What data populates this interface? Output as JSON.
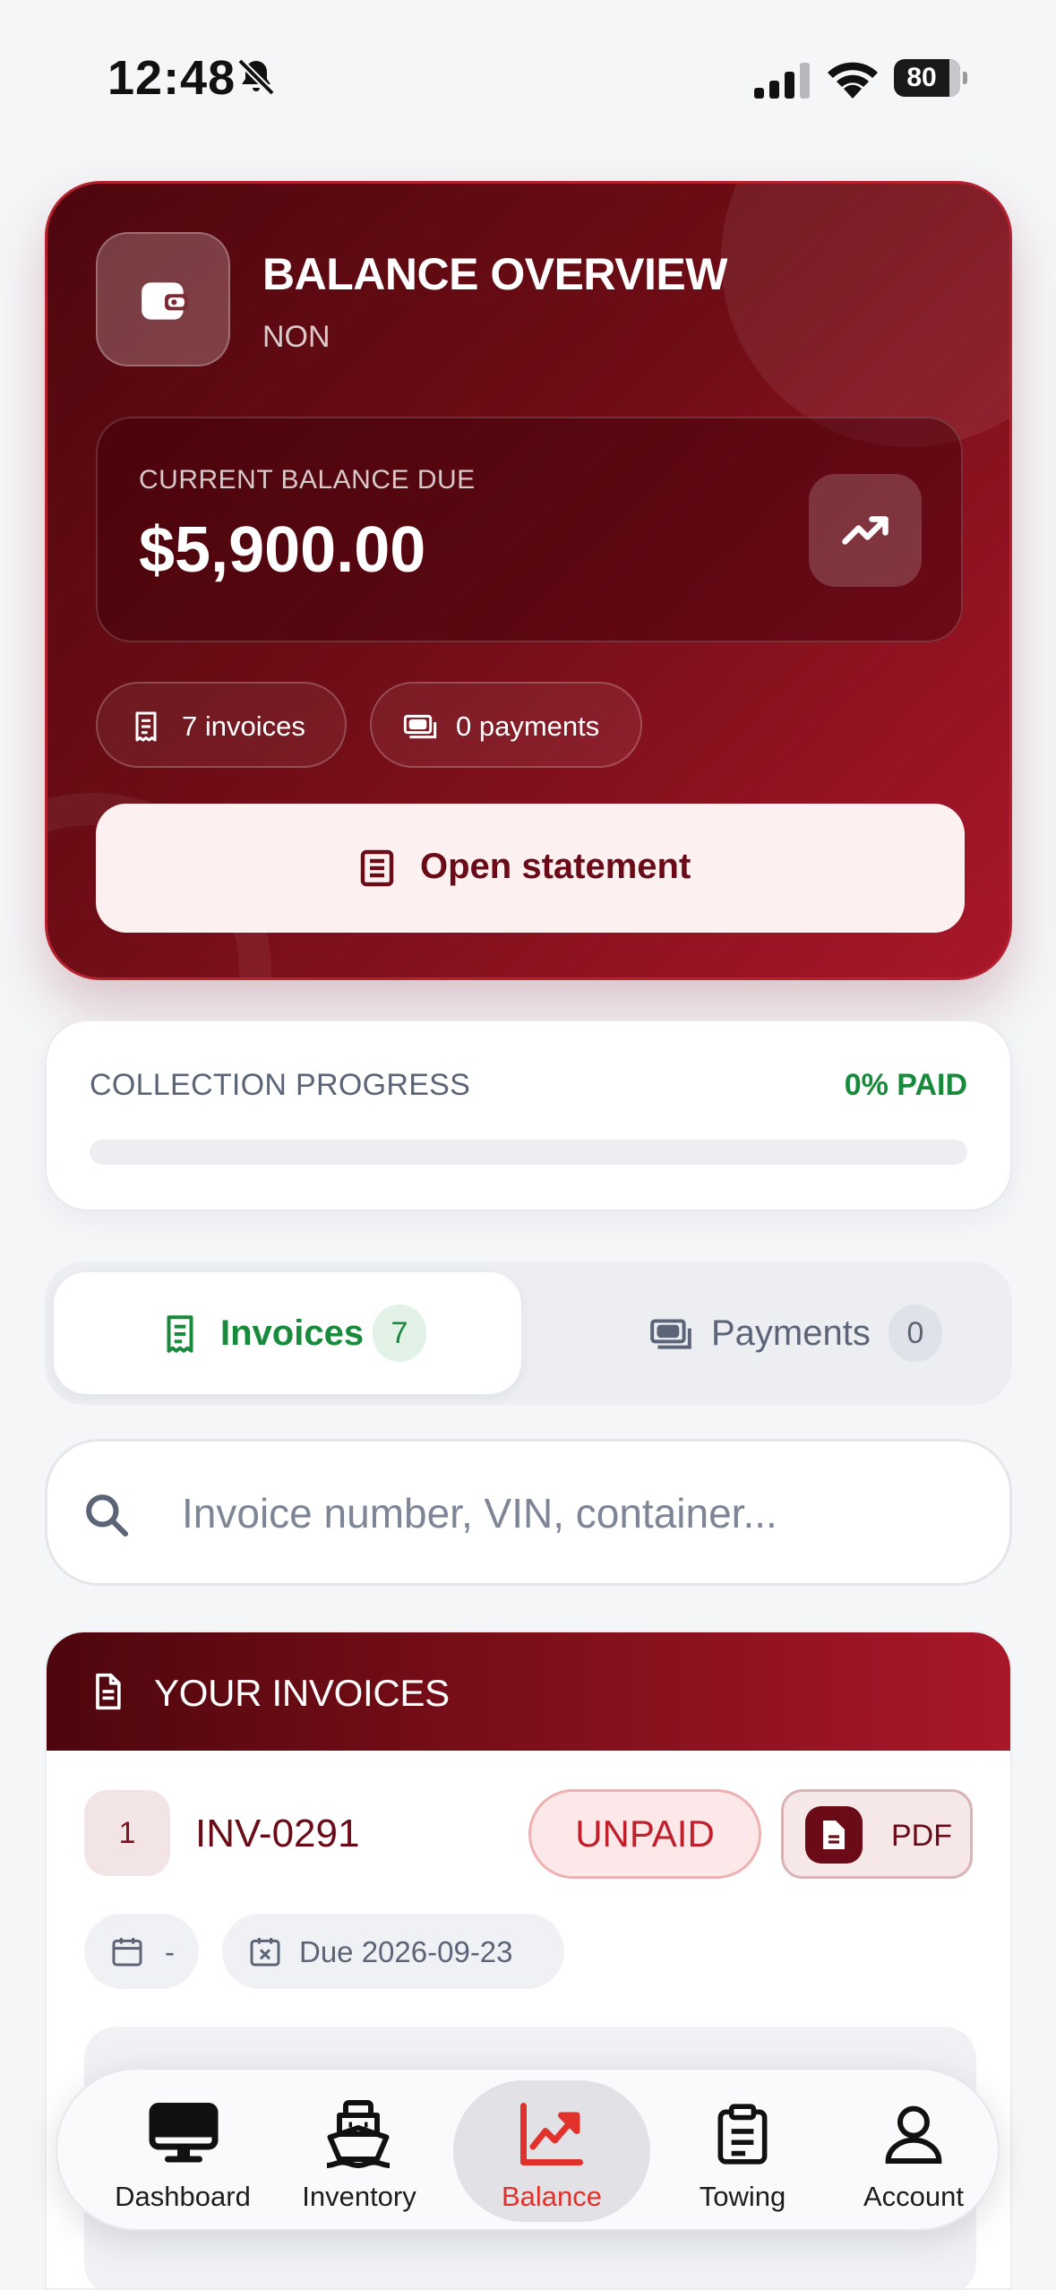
{
  "status_bar": {
    "time": "12:48",
    "battery": "80"
  },
  "balance_card": {
    "title": "BALANCE OVERVIEW",
    "subtitle": "NON",
    "due_label": "CURRENT BALANCE DUE",
    "due_amount": "$5,900.00",
    "invoices_chip": "7 invoices",
    "payments_chip": "0 payments",
    "statement_button": "Open statement"
  },
  "collection": {
    "label": "COLLECTION PROGRESS",
    "value_text": "0% PAID",
    "fraction_paid": 0
  },
  "tabs": {
    "invoices": {
      "label": "Invoices",
      "count": "7",
      "active": true
    },
    "payments": {
      "label": "Payments",
      "count": "0",
      "active": false
    }
  },
  "search": {
    "placeholder": "Invoice number, VIN, container...",
    "value": ""
  },
  "invoices": {
    "header": "YOUR INVOICES",
    "items": [
      {
        "index": "1",
        "number": "INV-0291",
        "status": "UNPAID",
        "pdf_label": "PDF",
        "issued": "-",
        "due": "Due 2026-09-23"
      }
    ]
  },
  "tabbar": {
    "items": [
      {
        "label": "Dashboard",
        "icon": "monitor-icon"
      },
      {
        "label": "Inventory",
        "icon": "ship-icon"
      },
      {
        "label": "Balance",
        "icon": "chart-line-icon",
        "active": true
      },
      {
        "label": "Towing",
        "icon": "clipboard-icon"
      },
      {
        "label": "Account",
        "icon": "person-icon"
      }
    ]
  },
  "colors": {
    "brand_dark": "#4e060d",
    "brand_red": "#a9172a",
    "paid_green": "#178a3c",
    "unpaid_red": "#c0202c",
    "active_tab": "#e0312b"
  }
}
